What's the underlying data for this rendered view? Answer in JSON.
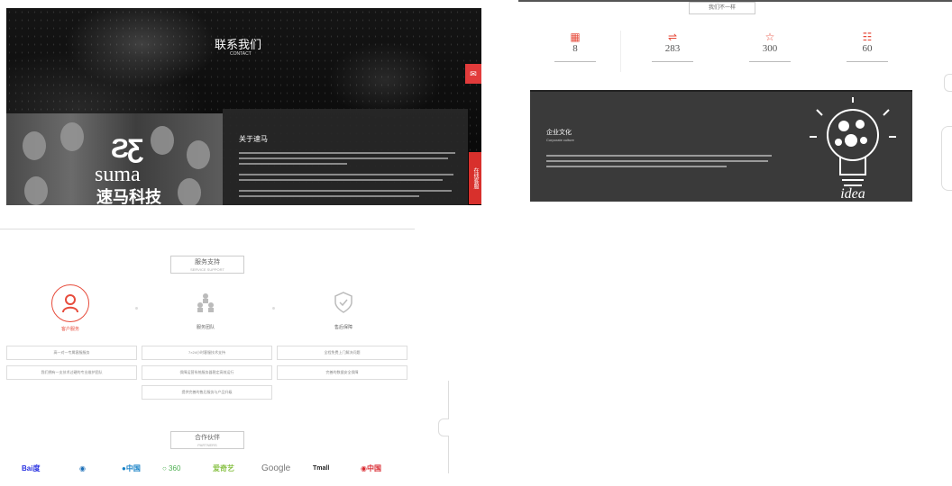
{
  "hero": {
    "title": "联系我们",
    "subtitle": "CONTACT",
    "side_button_icon": "message-icon",
    "side_tab": "在线客服",
    "logo_mark": "ƧƸ",
    "logo_en": "suma",
    "logo_cn": "速马科技",
    "about_title": "关于速马"
  },
  "stats_section": {
    "rank_label": "我们不一样",
    "items": [
      {
        "icon": "grid-icon",
        "glyph": "▦",
        "value": "8"
      },
      {
        "icon": "handshake-icon",
        "glyph": "⇌",
        "value": "283"
      },
      {
        "icon": "star-icon",
        "glyph": "☆",
        "value": "300"
      },
      {
        "icon": "team-icon",
        "glyph": "☷",
        "value": "60"
      }
    ],
    "culture_title": "企业文化",
    "culture_sub": "Corporate culture",
    "idea_word": "idea"
  },
  "services": {
    "title": "服务支持",
    "title_sub": "SERVICE SUPPORT",
    "items": [
      {
        "icon": "person-icon",
        "label": "客户服务"
      },
      {
        "icon": "people-icon",
        "label": "服务团队"
      },
      {
        "icon": "shield-check-icon",
        "label": "售后保障"
      }
    ],
    "cells": [
      "高一对一专属客服服务",
      "7×24小时客服技术支持",
      "全程免费上门解决问题",
      "我们拥有一支技术过硬的专业维护团队",
      "保障运营系统服务器稳定高效运行",
      "完善的数据安全保障",
      "提供完善的售后服务与产品升级"
    ],
    "colors": {
      "accent": "#e74c3c",
      "muted": "#bbbbbb"
    }
  },
  "partners": {
    "title": "合作伙伴",
    "title_sub": "PARTNERS",
    "logos": [
      {
        "name": "Baidu",
        "text": "Bai度",
        "color": "#2932e1"
      },
      {
        "name": "Hainan Airlines",
        "text": "◉",
        "color": "#1c6fb8"
      },
      {
        "name": "China Telecom",
        "text": "●中国",
        "color": "#1580c6"
      },
      {
        "name": "360",
        "text": "○ 360",
        "color": "#4caf50"
      },
      {
        "name": "iQIYI",
        "text": "爱奇艺",
        "color": "#8bc34a"
      },
      {
        "name": "Google",
        "text": "Google",
        "color": "#777777"
      },
      {
        "name": "Tmall",
        "text": "Tmall",
        "color": "#222222"
      },
      {
        "name": "China Unicom",
        "text": "◉中国",
        "color": "#d9282f"
      }
    ]
  }
}
